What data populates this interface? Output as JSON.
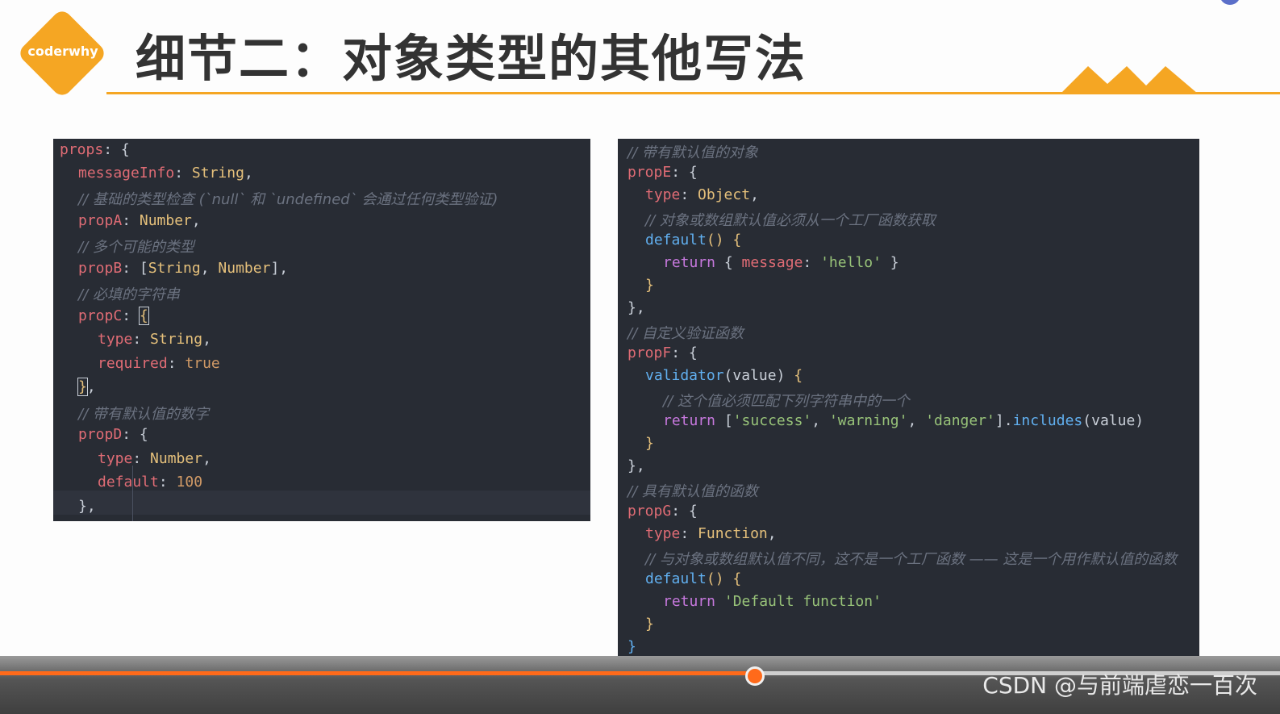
{
  "header": {
    "logo_text": "coderwhy",
    "title": "细节二：对象类型的其他写法",
    "accent": "#f5a623"
  },
  "left_code": {
    "lines": [
      [
        "props: {"
      ],
      [
        "messageInfo: String,"
      ],
      [
        "// 基础的类型检查 (`null` 和 `undefined` 会通过任何类型验证)"
      ],
      [
        "propA: Number,"
      ],
      [
        "// 多个可能的类型"
      ],
      [
        "propB: [String, Number],"
      ],
      [
        "// 必填的字符串"
      ],
      [
        "propC: {"
      ],
      [
        "type: String,"
      ],
      [
        "required: true"
      ],
      [
        "},"
      ],
      [
        "// 带有默认值的数字"
      ],
      [
        "propD: {"
      ],
      [
        "type: Number,"
      ],
      [
        "default: 100"
      ],
      [
        "},"
      ]
    ],
    "t": {
      "l0a": "props",
      "l0b": ": {",
      "l1a": "messageInfo",
      "l1b": ": ",
      "l1c": "String",
      "l1d": ",",
      "l2": "// 基础的类型检查 (`null` 和 `undefined` 会通过任何类型验证)",
      "l3a": "propA",
      "l3b": ": ",
      "l3c": "Number",
      "l3d": ",",
      "l4": "// 多个可能的类型",
      "l5a": "propB",
      "l5b": ": [",
      "l5c": "String",
      "l5d": ", ",
      "l5e": "Number",
      "l5f": "],",
      "l6": "// 必填的字符串",
      "l7a": "propC",
      "l7b": ": ",
      "l7c": "{",
      "l8a": "type",
      "l8b": ": ",
      "l8c": "String",
      "l8d": ",",
      "l9a": "required",
      "l9b": ": ",
      "l9c": "true",
      "l10a": "}",
      "l10b": ",",
      "l11": "// 带有默认值的数字",
      "l12a": "propD",
      "l12b": ": {",
      "l13a": "type",
      "l13b": ": ",
      "l13c": "Number",
      "l13d": ",",
      "l14a": "default",
      "l14b": ": ",
      "l14c": "100",
      "l15": "},"
    }
  },
  "right_code": {
    "t": {
      "r0": "// 带有默认值的对象",
      "r1a": "propE",
      "r1b": ": {",
      "r2a": "type",
      "r2b": ": ",
      "r2c": "Object",
      "r2d": ",",
      "r3": "// 对象或数组默认值必须从一个工厂函数获取",
      "r4a": "default",
      "r4b": "() ",
      "r4c": "{",
      "r5a": "return",
      "r5b": " { ",
      "r5c": "message",
      "r5d": ": ",
      "r5e": "'hello'",
      "r5f": " }",
      "r6": "}",
      "r7": "},",
      "r8": "// 自定义验证函数",
      "r9a": "propF",
      "r9b": ": {",
      "r10a": "validator",
      "r10b": "(value) ",
      "r10c": "{",
      "r11": "// 这个值必须匹配下列字符串中的一个",
      "r12a": "return",
      "r12b": " [",
      "r12c": "'success'",
      "r12d": ", ",
      "r12e": "'warning'",
      "r12f": ", ",
      "r12g": "'danger'",
      "r12h": "].",
      "r12i": "includes",
      "r12j": "(value)",
      "r13": "}",
      "r14": "},",
      "r15": "// 具有默认值的函数",
      "r16a": "propG",
      "r16b": ": {",
      "r17a": "type",
      "r17b": ": ",
      "r17c": "Function",
      "r17d": ",",
      "r18": "// 与对象或数组默认值不同，这不是一个工厂函数 —— 这是一个用作默认值的函数",
      "r19a": "default",
      "r19b": "() ",
      "r19c": "{",
      "r20a": "return",
      "r20b": " ",
      "r20c": "'Default function'",
      "r21": "}",
      "r22": "}"
    }
  },
  "player": {
    "progress": 0.59,
    "played_color": "#ff6a1a",
    "watermark": "CSDN @与前端虐恋一百次"
  }
}
